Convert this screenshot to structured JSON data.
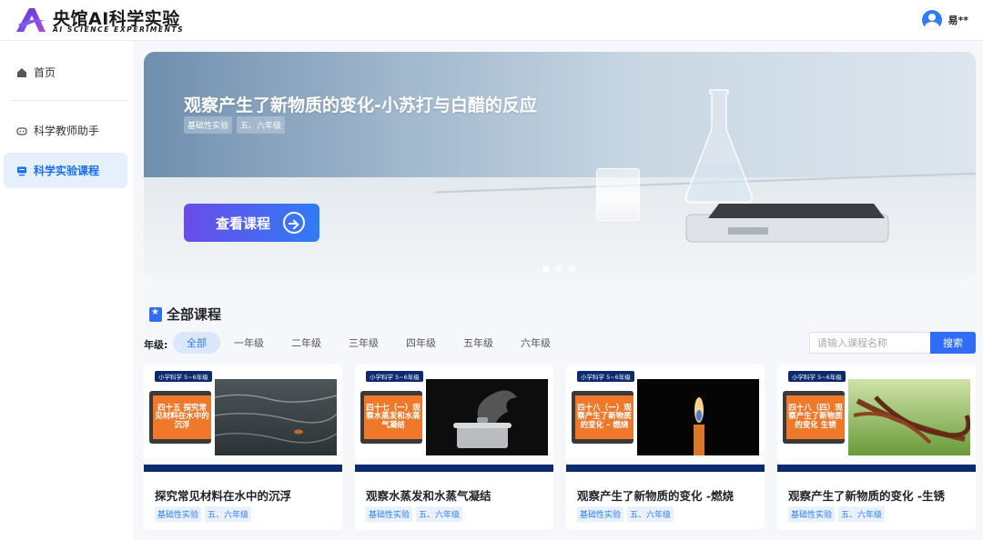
{
  "header": {
    "brand_title": "央馆AI科学实验",
    "brand_subtitle": "AI SCIENCE EXPERIMENTS",
    "user_name": "易**"
  },
  "sidebar": {
    "items": [
      {
        "label": "首页",
        "icon": "home-icon"
      },
      {
        "label": "科学教师助手",
        "icon": "robot-icon"
      },
      {
        "label": "科学实验课程",
        "icon": "course-icon",
        "active": true
      }
    ]
  },
  "banner": {
    "title": "观察产生了新物质的变化-小苏打与白醋的反应",
    "tags": [
      "基础性实验",
      "五、六年级"
    ],
    "button_label": "查看课程",
    "active_slide": 1,
    "slide_count": 3
  },
  "courses": {
    "section_title": "全部课程",
    "grade_label": "年级:",
    "grades": [
      "全部",
      "一年级",
      "二年级",
      "三年级",
      "四年级",
      "五年级",
      "六年级"
    ],
    "active_grade": "全部",
    "search_placeholder": "请输入课程名称",
    "search_button": "搜索",
    "items": [
      {
        "badge": "小学科学 5~6年级",
        "cover_text": "四十五 探究常见材料在水中的沉浮",
        "title": "探究常见材料在水中的沉浮",
        "tags": [
          "基础性实验",
          "五、六年级"
        ],
        "photo": "water"
      },
      {
        "badge": "小学科学 5~6年级",
        "cover_text": "四十七（一）观察水蒸发和水蒸气凝结",
        "title": "观察水蒸发和水蒸气凝结",
        "tags": [
          "基础性实验",
          "五、六年级"
        ],
        "photo": "steam"
      },
      {
        "badge": "小学科学 5~6年级",
        "cover_text": "四十八（一）观察产生了新物质的变化 – 燃烧",
        "title": "观察产生了新物质的变化 -燃烧",
        "tags": [
          "基础性实验",
          "五、六年级"
        ],
        "photo": "candle"
      },
      {
        "badge": "小学科学 5~6年级",
        "cover_text": "四十八（四）观察产生了新物质的变化 生锈",
        "title": "观察产生了新物质的变化 -生锈",
        "tags": [
          "基础性实验",
          "五、六年级"
        ],
        "photo": "rust"
      }
    ]
  },
  "colors": {
    "accent": "#2f6df6",
    "active_bg": "#e6f0fd",
    "card_bar": "#0b2b6e",
    "cover_orange": "#f0782a"
  }
}
